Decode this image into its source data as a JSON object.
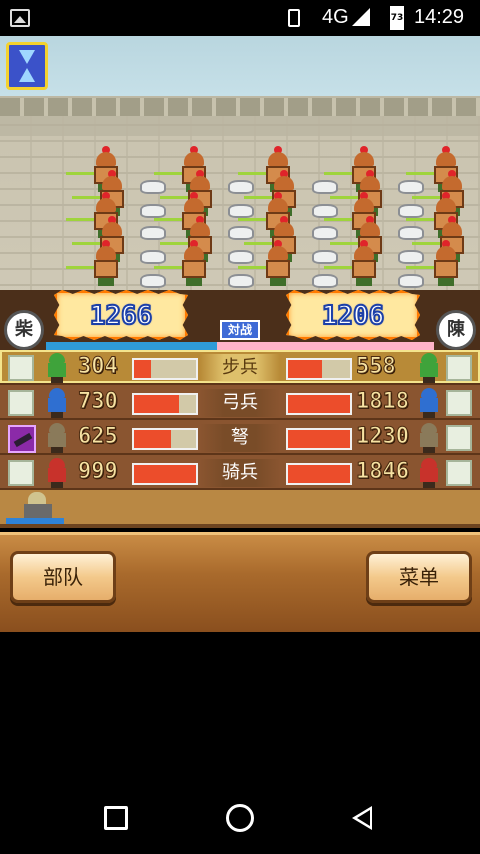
{
  "status_bar": {
    "network": "4G",
    "battery": "73",
    "time": "14:29"
  },
  "battle": {
    "left_total": "1266",
    "right_total": "1206",
    "left_seal": "柴",
    "right_seal": "陳",
    "vs_label": "対战",
    "morale_left_fraction": 0.44
  },
  "units": [
    {
      "name": "步兵",
      "left_count": "304",
      "left_hp": 0.28,
      "right_count": "558",
      "right_hp": 0.55,
      "active": true,
      "left_color": "#3fa33b",
      "right_color": "#3fa33b"
    },
    {
      "name": "弓兵",
      "left_count": "730",
      "left_hp": 0.72,
      "right_count": "1818",
      "right_hp": 1.0,
      "active": false,
      "left_color": "#2f6fd1",
      "right_color": "#2f6fd1"
    },
    {
      "name": "弩",
      "left_count": "625",
      "left_hp": 0.6,
      "right_count": "1230",
      "right_hp": 1.0,
      "active": false,
      "left_color": "#8a7a5a",
      "right_color": "#8a7a5a"
    },
    {
      "name": "骑兵",
      "left_count": "999",
      "left_hp": 1.0,
      "right_count": "1846",
      "right_hp": 1.0,
      "active": false,
      "left_color": "#c8322b",
      "right_color": "#c8322b"
    }
  ],
  "panel": {
    "troops_button": "部队",
    "menu_button": "菜单"
  }
}
